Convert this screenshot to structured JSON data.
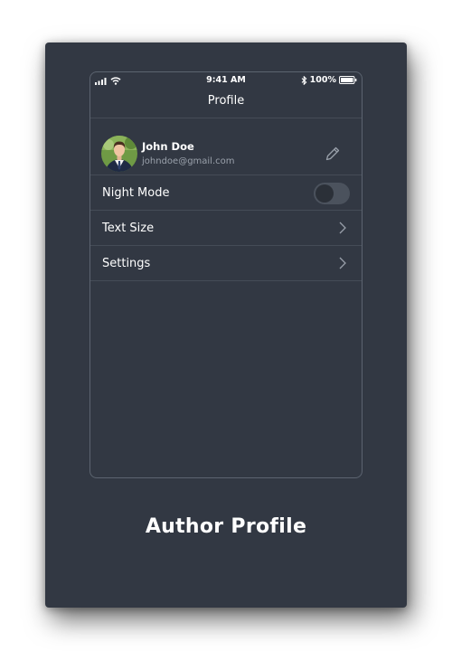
{
  "status_bar": {
    "time": "9:41 AM",
    "battery_text": "100%"
  },
  "nav": {
    "title": "Profile"
  },
  "profile": {
    "name": "John Doe",
    "email": "johndoe@gmail.com"
  },
  "menu": {
    "night_mode": {
      "label": "Night Mode",
      "enabled": false
    },
    "text_size": {
      "label": "Text Size"
    },
    "settings": {
      "label": "Settings"
    }
  },
  "caption": "Author Profile",
  "colors": {
    "background": "#323843",
    "divider": "#454c57",
    "text_primary": "#ffffff",
    "text_secondary": "#9aa1ab"
  },
  "icons": [
    "signal-icon",
    "wifi-icon",
    "bluetooth-icon",
    "battery-icon",
    "pencil-icon",
    "chevron-right-icon"
  ]
}
